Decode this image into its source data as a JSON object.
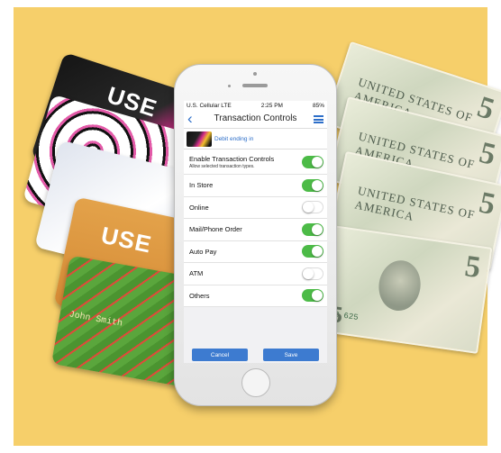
{
  "colors": {
    "background": "#f6cf6a",
    "accent": "#2e6fc9",
    "toggle_on": "#4cbb47",
    "button": "#3d7bd0"
  },
  "statusbar": {
    "left": "U.S. Cellular  LTE",
    "time": "2:25 PM",
    "right": "85%"
  },
  "navbar": {
    "back_icon": "chevron-left-icon",
    "title": "Transaction Controls",
    "menu_icon": "hamburger-menu-icon"
  },
  "account": {
    "label": "Debit ending in"
  },
  "controls": [
    {
      "label": "Enable Transaction Controls",
      "sublabel": "Allow selected transaction types.",
      "on": true
    },
    {
      "label": "In Store",
      "on": true
    },
    {
      "label": "Online",
      "on": false
    },
    {
      "label": "Mail/Phone Order",
      "on": true
    },
    {
      "label": "Auto Pay",
      "on": true
    },
    {
      "label": "ATM",
      "on": false
    },
    {
      "label": "Others",
      "on": true
    }
  ],
  "buttons": {
    "cancel": "Cancel",
    "save": "Save"
  },
  "cards": {
    "logo": "USE",
    "holder_name": "John Smith"
  },
  "bills": {
    "denomination": "5",
    "country": "UNITED STATES OF AMERICA",
    "serial": "IB 625"
  }
}
